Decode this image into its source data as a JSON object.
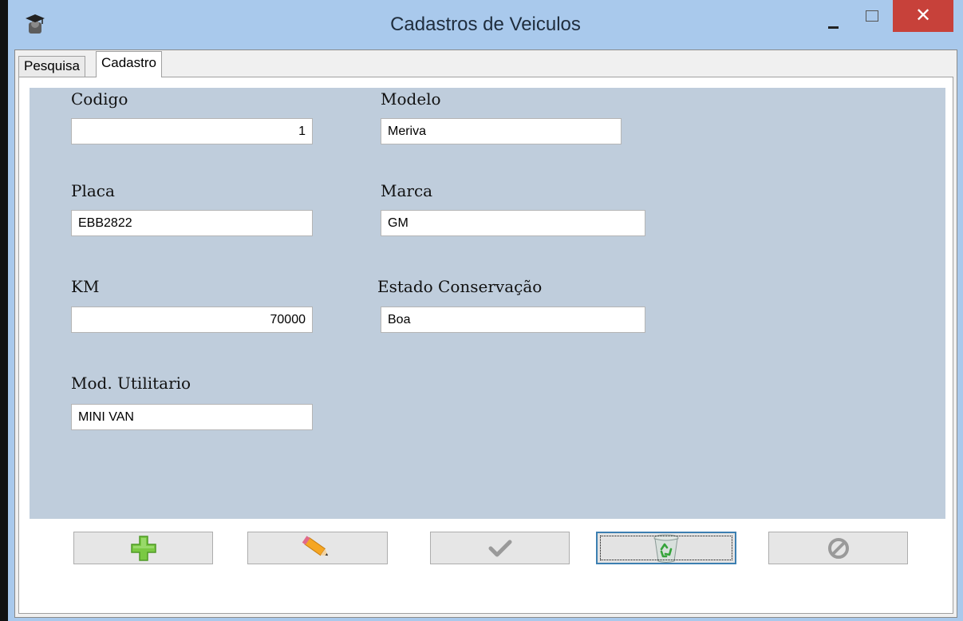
{
  "window": {
    "title": "Cadastros de Veiculos",
    "close_glyph": "✕"
  },
  "tabs": [
    {
      "label": "Pesquisa"
    },
    {
      "label": "Cadastro"
    }
  ],
  "form": {
    "codigo": {
      "label": "Codigo",
      "value": "1"
    },
    "modelo": {
      "label": "Modelo",
      "value": "Meriva"
    },
    "placa": {
      "label": "Placa",
      "value": "EBB2822"
    },
    "marca": {
      "label": "Marca",
      "value": "GM"
    },
    "km": {
      "label": "KM",
      "value": "70000"
    },
    "estado": {
      "label": "Estado Conservação",
      "value": "Boa"
    },
    "utilitario": {
      "label": "Mod. Utilitario",
      "value": "MINI VAN"
    }
  },
  "toolbar": [
    {
      "name": "add",
      "icon": "plus-icon",
      "enabled": true
    },
    {
      "name": "edit",
      "icon": "pencil-icon",
      "enabled": true
    },
    {
      "name": "save",
      "icon": "check-icon",
      "enabled": false
    },
    {
      "name": "delete",
      "icon": "recycle-bin-icon",
      "enabled": true
    },
    {
      "name": "cancel",
      "icon": "cancel-icon",
      "enabled": false
    }
  ],
  "colors": {
    "title_bar": "#a9c9ec",
    "close_button": "#c7413a",
    "form_background": "#bfcddc",
    "add_icon": "#7ac943"
  }
}
